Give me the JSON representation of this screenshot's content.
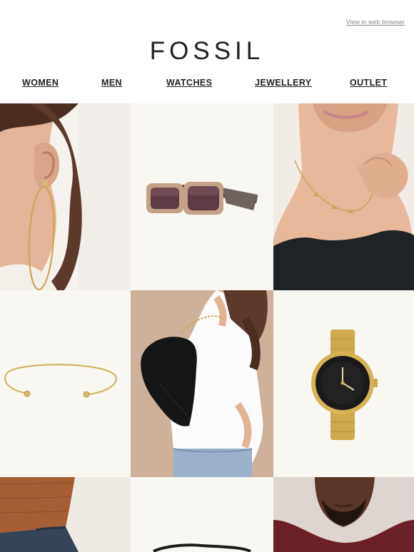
{
  "header": {
    "web_view_link": "View in web browser",
    "logo_text": "FOSSIL"
  },
  "nav": [
    {
      "label": "WOMEN"
    },
    {
      "label": "MEN"
    },
    {
      "label": "WATCHES"
    },
    {
      "label": "JEWELLERY"
    },
    {
      "label": "OUTLET"
    }
  ],
  "colors": {
    "tile_bg": "#f8f7f2",
    "skin": "#e5b99e",
    "gold": "#d4b056",
    "black": "#141414",
    "leather": "#c9a98f"
  },
  "tiles": [
    {
      "icon": "hoop-earring-model-image"
    },
    {
      "icon": "sunglasses-image"
    },
    {
      "icon": "necklace-model-image"
    },
    {
      "icon": "cuff-bracelet-image"
    },
    {
      "icon": "shoulder-bag-model-image"
    },
    {
      "icon": "gold-watch-image"
    },
    {
      "icon": "belt-model-image"
    },
    {
      "icon": "product-image"
    },
    {
      "icon": "men-model-image"
    }
  ]
}
